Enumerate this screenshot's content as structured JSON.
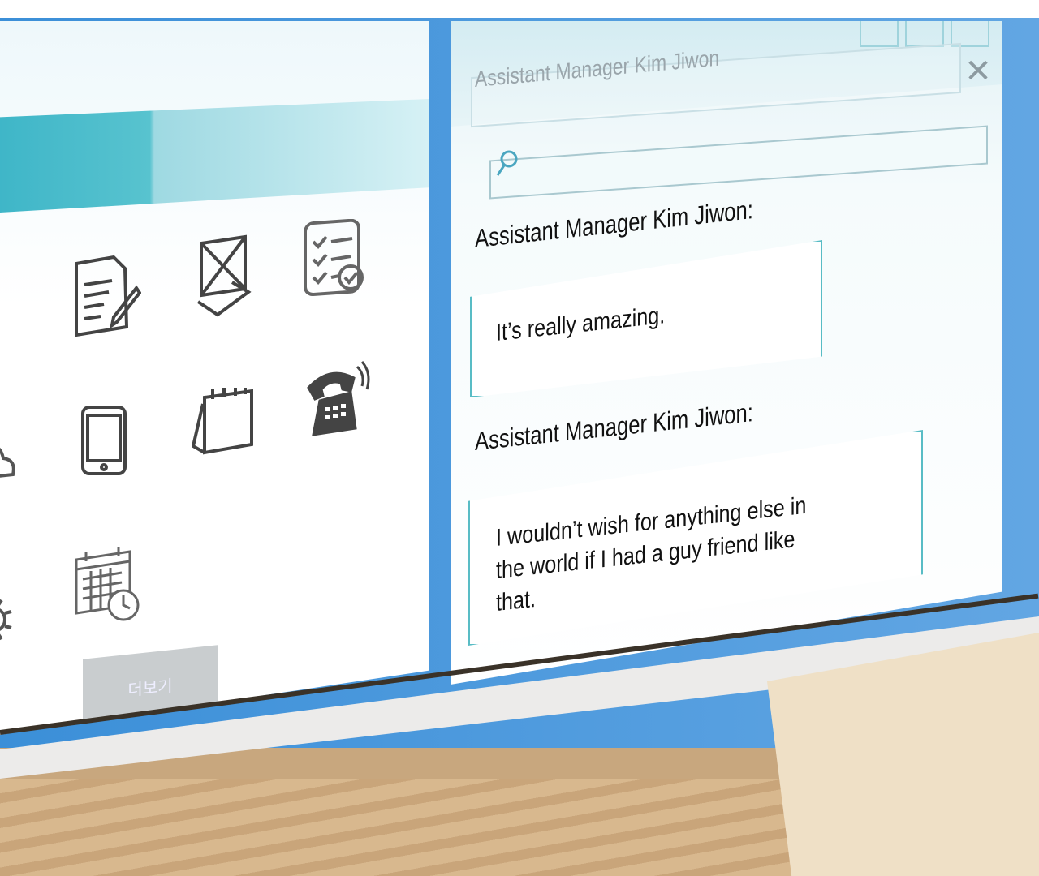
{
  "chat": {
    "window_title": "Assistant Manager Kim Jiwon",
    "close_symbol": "✕",
    "search": {
      "placeholder": ""
    },
    "messages": [
      {
        "sender": "Assistant Manager Kim Jiwon:",
        "text": "It’s really amazing."
      },
      {
        "sender": "Assistant Manager Kim Jiwon:",
        "text": "I wouldn’t wish for anything else in the world if I had a guy friend like that."
      }
    ]
  },
  "app_grid": {
    "more_button_label": "더보기",
    "icons": [
      "mail-icon",
      "document-edit-icon",
      "envelope-open-icon",
      "checklist-icon",
      "cloud-icon",
      "tablet-icon",
      "notepad-icon",
      "telephone-icon",
      "settings-icon",
      "calendar-clock-icon"
    ]
  },
  "colors": {
    "accent_teal": "#3fb6c8",
    "frame_blue": "#3b8fd8",
    "bubble_border": "#58bcc5"
  }
}
